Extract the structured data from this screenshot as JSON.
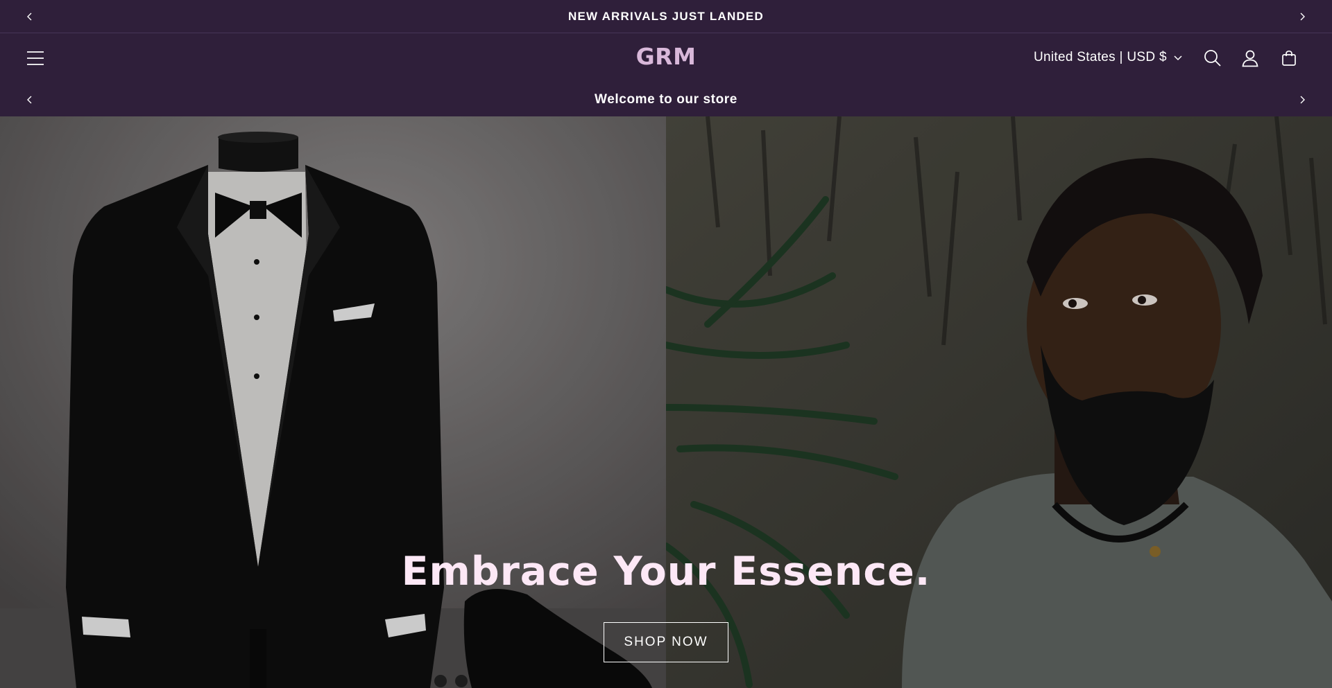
{
  "announcement_bar": {
    "text": "NEW ARRIVALS JUST LANDED"
  },
  "header": {
    "logo": "GRM",
    "locale_selector": "United States | USD $",
    "icons": [
      "menu-icon",
      "search-icon",
      "account-icon",
      "cart-icon"
    ]
  },
  "welcome_bar": {
    "text": "Welcome to our store"
  },
  "hero": {
    "heading": "Embrace Your Essence.",
    "button_label": "SHOP NOW"
  },
  "colors": {
    "header_background": "#2f1f3a",
    "logo": "#d9b8da",
    "heading": "#fde8f6",
    "text": "#ffffff"
  }
}
